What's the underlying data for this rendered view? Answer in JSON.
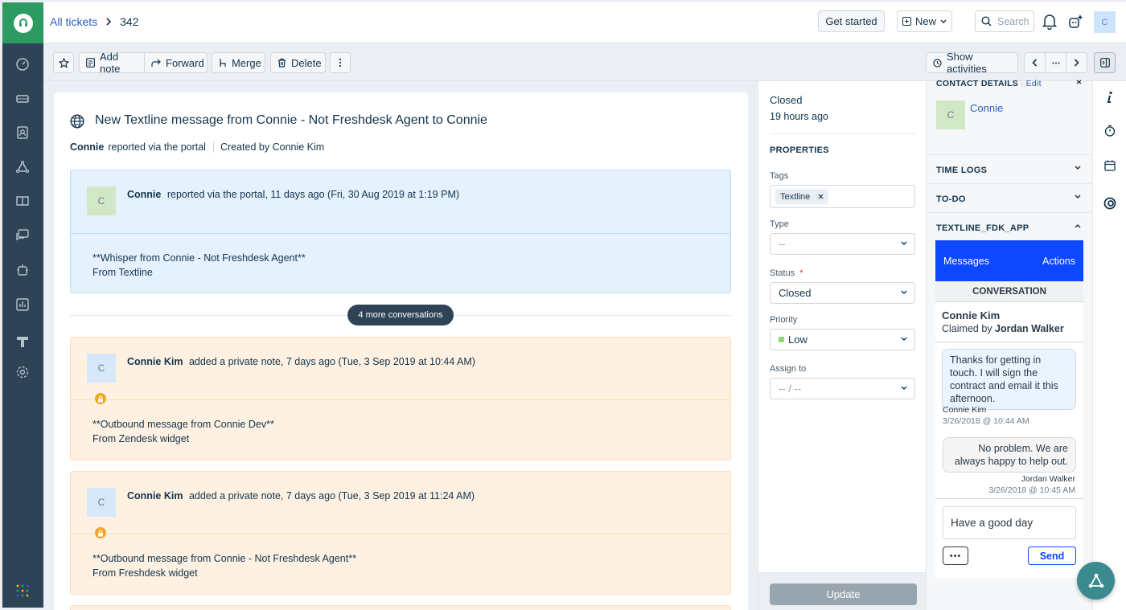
{
  "breadcrumb": {
    "all_tickets": "All tickets",
    "ticket_id": "342"
  },
  "topbar": {
    "get_started": "Get started",
    "new_label": "New",
    "search_placeholder": "Search",
    "avatar_initial": "C"
  },
  "toolbar": {
    "add_note": "Add note",
    "forward": "Forward",
    "merge": "Merge",
    "delete": "Delete",
    "show_activities": "Show activities"
  },
  "ticket": {
    "subject": "New Textline message from Connie - Not Freshdesk Agent to Connie",
    "requester": "Connie",
    "reported_via": "reported via the portal",
    "created_by": "Created by Connie Kim",
    "more_conversations": "4 more conversations",
    "conversations": [
      {
        "avatar": "C",
        "author": "Connie",
        "meta": "reported via the portal, 11 days ago (Fri, 30 Aug 2019 at 1:19 PM)",
        "line1": "**Whisper from Connie - Not Freshdesk Agent**",
        "line2": "From Textline"
      },
      {
        "avatar": "C",
        "author": "Connie Kim",
        "meta": "added a private note, 7 days ago (Tue, 3 Sep 2019 at 10:44 AM)",
        "line1": "**Outbound message from Connie Dev**",
        "line2": "From Zendesk widget"
      },
      {
        "avatar": "C",
        "author": "Connie Kim",
        "meta": "added a private note, 7 days ago (Tue, 3 Sep 2019 at 11:24 AM)",
        "line1": "**Outbound message from Connie - Not Freshdesk Agent**",
        "line2": "From Freshdesk widget"
      }
    ]
  },
  "properties": {
    "status_title": "Closed",
    "status_time": "19 hours ago",
    "heading": "PROPERTIES",
    "tags_label": "Tags",
    "tag": "Textline",
    "type_label": "Type",
    "type_value": "--",
    "status_label": "Status",
    "required_mark": "*",
    "status_value": "Closed",
    "priority_label": "Priority",
    "priority_value": "Low",
    "priority_color": "#8ed77d",
    "assign_label": "Assign to",
    "assign_value": "-- / --",
    "update_button": "Update"
  },
  "side": {
    "contact_details": "CONTACT DETAILS",
    "edit": "Edit",
    "contact_initial": "C",
    "contact_name": "Connie",
    "time_logs": "TIME LOGS",
    "todo": "TO-DO",
    "app_name": "TEXTLINE_FDK_APP"
  },
  "app": {
    "tab_messages": "Messages",
    "tab_actions": "Actions",
    "conversation_heading": "CONVERSATION",
    "contact_name": "Connie Kim",
    "claimed_prefix": "Claimed by",
    "claimed_by": "Jordan Walker",
    "msg1": "Thanks for getting in touch. I will sign the contract and email it this afternoon.",
    "msg1_author": "Connie Kim",
    "msg1_time": "3/26/2018 @ 10:44 AM",
    "msg2": "No problem. We are always happy to help out.",
    "msg2_author": "Jordan Walker",
    "msg2_time": "3/26/2018 @ 10:45 AM",
    "input_value": "Have a good day",
    "more": "•••",
    "send": "Send",
    "accent": "#0d47ff"
  },
  "colors": {
    "rail": "#2e4356",
    "brand_green": "#2c9a61",
    "link": "#2c5cc5"
  }
}
